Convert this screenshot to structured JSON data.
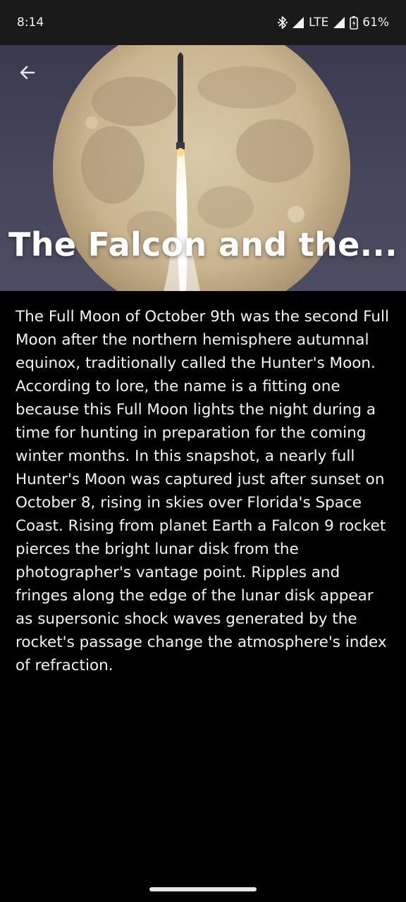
{
  "status_bar": {
    "time": "8:14",
    "network": "LTE",
    "battery": "61%",
    "icons": [
      "bluetooth-icon",
      "signal-icon",
      "signal-icon",
      "battery-icon"
    ]
  },
  "article": {
    "title": "The Falcon and the...",
    "body": "The Full Moon of October 9th was the second Full Moon after the northern hemisphere autumnal equinox, traditionally called the Hunter's Moon. According to lore, the name is a fitting one because this Full Moon lights the night during a time for hunting in preparation for the coming winter months. In this snapshot, a nearly full Hunter's Moon was captured just after sunset on October 8, rising in skies over Florida's Space Coast. Rising from planet Earth a Falcon 9 rocket pierces the bright lunar disk from the photographer's vantage point. Ripples and fringes along the edge of the lunar disk appear as supersonic shock waves generated by the rocket's passage change the atmosphere's index of refraction."
  },
  "navigation": {
    "back_icon": "arrow-left-icon"
  },
  "colors": {
    "background": "#000000",
    "status_bar": "#1a1a1a",
    "text": "#f4f4f4"
  }
}
